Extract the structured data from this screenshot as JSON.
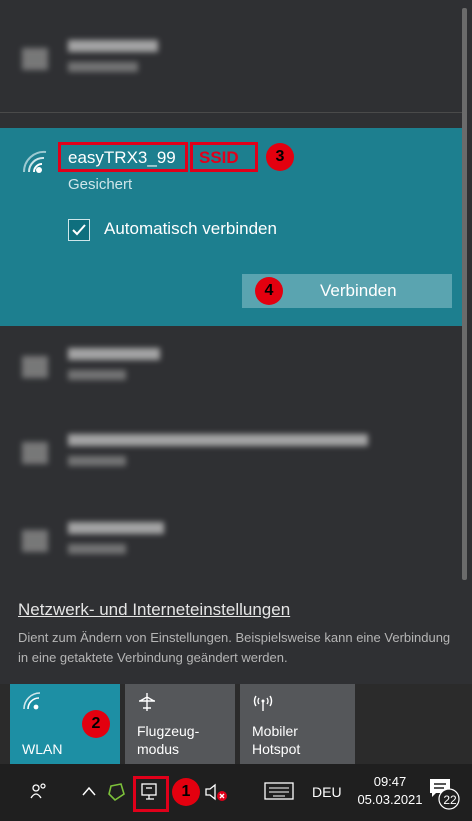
{
  "selected_network": {
    "ssid": "easyTRX3_99",
    "ssid_annotation": "SSID",
    "security": "Gesichert",
    "auto_connect_label": "Automatisch verbinden",
    "auto_connect_checked": true,
    "connect_label": "Verbinden"
  },
  "badges": {
    "taskbar_network": "1",
    "wlan_tile": "2",
    "ssid": "3",
    "connect": "4"
  },
  "footer": {
    "settings_link": "Netzwerk- und Interneteinstellungen",
    "description": "Dient zum Ändern von Einstellungen. Beispielsweise kann eine Verbindung in eine getaktete Verbindung geändert werden."
  },
  "quick_actions": [
    {
      "label": "WLAN",
      "icon": "wifi-icon",
      "active": true
    },
    {
      "label": "Flugzeug-\nmodus",
      "icon": "airplane-icon",
      "active": false
    },
    {
      "label": "Mobiler\nHotspot",
      "icon": "hotspot-icon",
      "active": false
    }
  ],
  "taskbar": {
    "language": "DEU",
    "time": "09:47",
    "date": "05.03.2021",
    "notification_count": "22"
  },
  "colors": {
    "accent": "#1d7f8f",
    "annotation_red": "#e0001a"
  }
}
